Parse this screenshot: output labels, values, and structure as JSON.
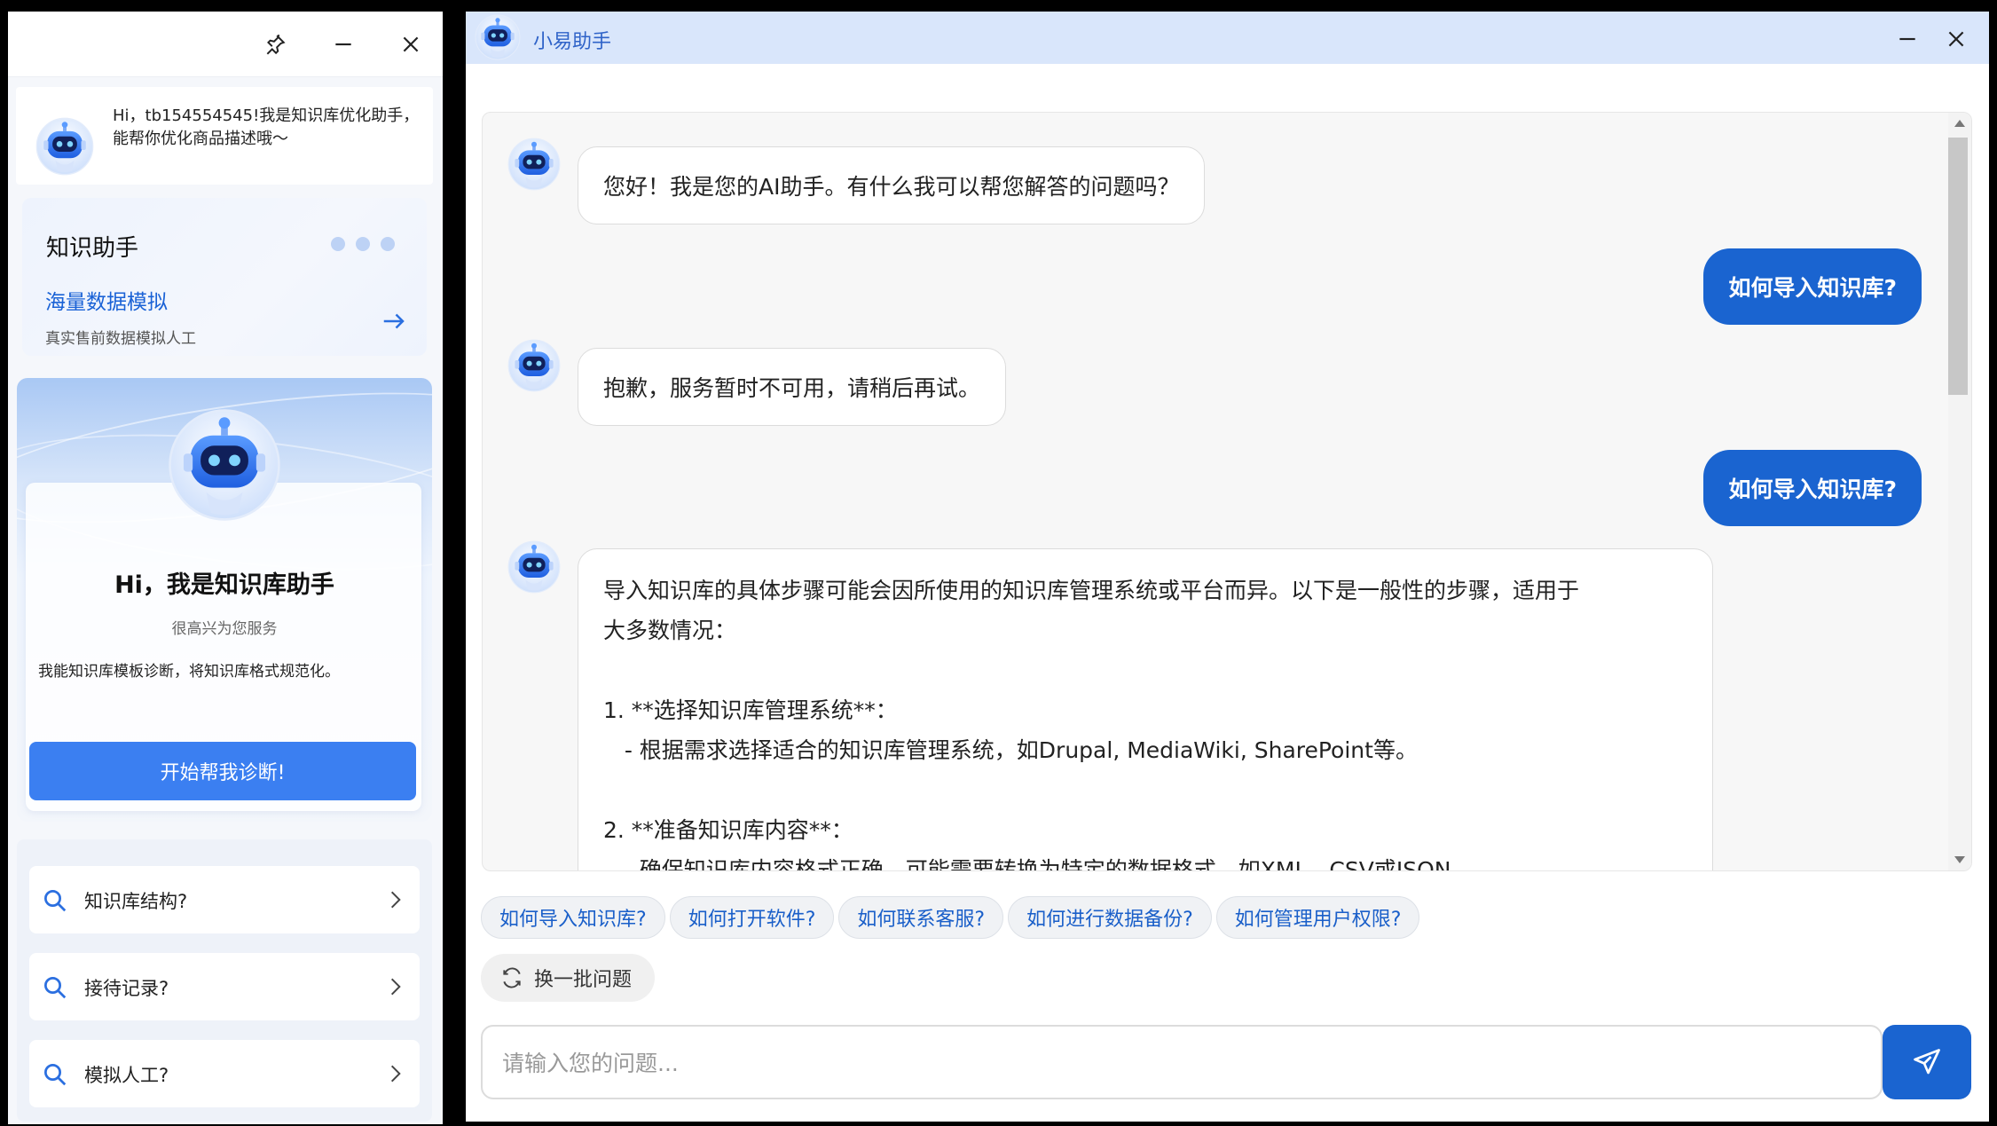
{
  "left_panel": {
    "titlebar": {
      "pin_icon": "pin-icon",
      "minimize_icon": "minimize-icon",
      "close_icon": "close-icon"
    },
    "greeting": "Hi，tb154554545!我是知识库优化助手，能帮你优化商品描述哦～",
    "knowledge_card": {
      "title": "知识助手",
      "link": "海量数据模拟",
      "subtitle": "真实售前数据模拟人工"
    },
    "hero": {
      "title": "Hi，我是知识库助手",
      "subtitle": "很高兴为您服务",
      "description": "我能知识库模板诊断，将知识库格式规范化。",
      "button": "开始帮我诊断!"
    },
    "faq": [
      {
        "label": "知识库结构?"
      },
      {
        "label": "接待记录?"
      },
      {
        "label": "模拟人工?"
      }
    ]
  },
  "right_panel": {
    "title": "小易助手",
    "messages": [
      {
        "role": "bot",
        "text": "您好！我是您的AI助手。有什么我可以帮您解答的问题吗？"
      },
      {
        "role": "user",
        "text": "如何导入知识库?"
      },
      {
        "role": "bot",
        "text": "抱歉，服务暂时不可用，请稍后再试。"
      },
      {
        "role": "user",
        "text": "如何导入知识库?"
      },
      {
        "role": "bot",
        "lines": [
          "导入知识库的具体步骤可能会因所使用的知识库管理系统或平台而异。以下是一般性的步骤，适用于",
          "大多数情况：",
          "",
          "1. **选择知识库管理系统**：",
          "   - 根据需求选择适合的知识库管理系统，如Drupal, MediaWiki, SharePoint等。",
          "",
          "2. **准备知识库内容**：",
          "   - 确保知识库内容格式正确，可能需要转换为特定的数据格式，如XML、CSV或JSON。"
        ]
      }
    ],
    "suggestions": [
      "如何导入知识库?",
      "如何打开软件?",
      "如何联系客服?",
      "如何进行数据备份?",
      "如何管理用户权限?"
    ],
    "refresh_label": "换一批问题",
    "input_placeholder": "请输入您的问题..."
  },
  "colors": {
    "accent": "#1a64d0",
    "button_blue": "#3b7ff1",
    "titlebar_bg": "#d9e6fb"
  }
}
